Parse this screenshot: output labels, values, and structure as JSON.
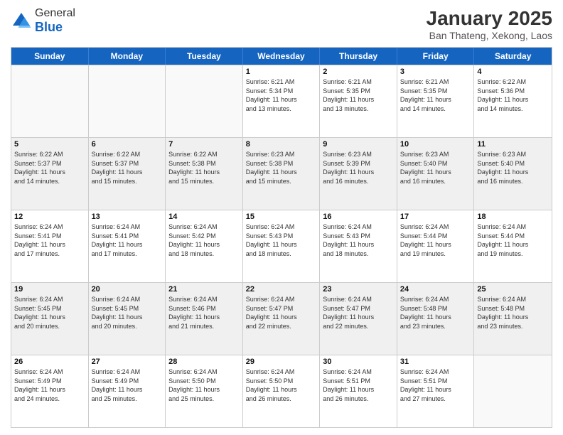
{
  "header": {
    "logo_general": "General",
    "logo_blue": "Blue",
    "month": "January 2025",
    "location": "Ban Thateng, Xekong, Laos"
  },
  "days_of_week": [
    "Sunday",
    "Monday",
    "Tuesday",
    "Wednesday",
    "Thursday",
    "Friday",
    "Saturday"
  ],
  "weeks": [
    [
      {
        "day": "",
        "text": "",
        "empty": true
      },
      {
        "day": "",
        "text": "",
        "empty": true
      },
      {
        "day": "",
        "text": "",
        "empty": true
      },
      {
        "day": "1",
        "text": "Sunrise: 6:21 AM\nSunset: 5:34 PM\nDaylight: 11 hours\nand 13 minutes."
      },
      {
        "day": "2",
        "text": "Sunrise: 6:21 AM\nSunset: 5:35 PM\nDaylight: 11 hours\nand 13 minutes."
      },
      {
        "day": "3",
        "text": "Sunrise: 6:21 AM\nSunset: 5:35 PM\nDaylight: 11 hours\nand 14 minutes."
      },
      {
        "day": "4",
        "text": "Sunrise: 6:22 AM\nSunset: 5:36 PM\nDaylight: 11 hours\nand 14 minutes."
      }
    ],
    [
      {
        "day": "5",
        "text": "Sunrise: 6:22 AM\nSunset: 5:37 PM\nDaylight: 11 hours\nand 14 minutes."
      },
      {
        "day": "6",
        "text": "Sunrise: 6:22 AM\nSunset: 5:37 PM\nDaylight: 11 hours\nand 15 minutes."
      },
      {
        "day": "7",
        "text": "Sunrise: 6:22 AM\nSunset: 5:38 PM\nDaylight: 11 hours\nand 15 minutes."
      },
      {
        "day": "8",
        "text": "Sunrise: 6:23 AM\nSunset: 5:38 PM\nDaylight: 11 hours\nand 15 minutes."
      },
      {
        "day": "9",
        "text": "Sunrise: 6:23 AM\nSunset: 5:39 PM\nDaylight: 11 hours\nand 16 minutes."
      },
      {
        "day": "10",
        "text": "Sunrise: 6:23 AM\nSunset: 5:40 PM\nDaylight: 11 hours\nand 16 minutes."
      },
      {
        "day": "11",
        "text": "Sunrise: 6:23 AM\nSunset: 5:40 PM\nDaylight: 11 hours\nand 16 minutes."
      }
    ],
    [
      {
        "day": "12",
        "text": "Sunrise: 6:24 AM\nSunset: 5:41 PM\nDaylight: 11 hours\nand 17 minutes."
      },
      {
        "day": "13",
        "text": "Sunrise: 6:24 AM\nSunset: 5:41 PM\nDaylight: 11 hours\nand 17 minutes."
      },
      {
        "day": "14",
        "text": "Sunrise: 6:24 AM\nSunset: 5:42 PM\nDaylight: 11 hours\nand 18 minutes."
      },
      {
        "day": "15",
        "text": "Sunrise: 6:24 AM\nSunset: 5:43 PM\nDaylight: 11 hours\nand 18 minutes."
      },
      {
        "day": "16",
        "text": "Sunrise: 6:24 AM\nSunset: 5:43 PM\nDaylight: 11 hours\nand 18 minutes."
      },
      {
        "day": "17",
        "text": "Sunrise: 6:24 AM\nSunset: 5:44 PM\nDaylight: 11 hours\nand 19 minutes."
      },
      {
        "day": "18",
        "text": "Sunrise: 6:24 AM\nSunset: 5:44 PM\nDaylight: 11 hours\nand 19 minutes."
      }
    ],
    [
      {
        "day": "19",
        "text": "Sunrise: 6:24 AM\nSunset: 5:45 PM\nDaylight: 11 hours\nand 20 minutes."
      },
      {
        "day": "20",
        "text": "Sunrise: 6:24 AM\nSunset: 5:45 PM\nDaylight: 11 hours\nand 20 minutes."
      },
      {
        "day": "21",
        "text": "Sunrise: 6:24 AM\nSunset: 5:46 PM\nDaylight: 11 hours\nand 21 minutes."
      },
      {
        "day": "22",
        "text": "Sunrise: 6:24 AM\nSunset: 5:47 PM\nDaylight: 11 hours\nand 22 minutes."
      },
      {
        "day": "23",
        "text": "Sunrise: 6:24 AM\nSunset: 5:47 PM\nDaylight: 11 hours\nand 22 minutes."
      },
      {
        "day": "24",
        "text": "Sunrise: 6:24 AM\nSunset: 5:48 PM\nDaylight: 11 hours\nand 23 minutes."
      },
      {
        "day": "25",
        "text": "Sunrise: 6:24 AM\nSunset: 5:48 PM\nDaylight: 11 hours\nand 23 minutes."
      }
    ],
    [
      {
        "day": "26",
        "text": "Sunrise: 6:24 AM\nSunset: 5:49 PM\nDaylight: 11 hours\nand 24 minutes."
      },
      {
        "day": "27",
        "text": "Sunrise: 6:24 AM\nSunset: 5:49 PM\nDaylight: 11 hours\nand 25 minutes."
      },
      {
        "day": "28",
        "text": "Sunrise: 6:24 AM\nSunset: 5:50 PM\nDaylight: 11 hours\nand 25 minutes."
      },
      {
        "day": "29",
        "text": "Sunrise: 6:24 AM\nSunset: 5:50 PM\nDaylight: 11 hours\nand 26 minutes."
      },
      {
        "day": "30",
        "text": "Sunrise: 6:24 AM\nSunset: 5:51 PM\nDaylight: 11 hours\nand 26 minutes."
      },
      {
        "day": "31",
        "text": "Sunrise: 6:24 AM\nSunset: 5:51 PM\nDaylight: 11 hours\nand 27 minutes."
      },
      {
        "day": "",
        "text": "",
        "empty": true
      }
    ]
  ]
}
